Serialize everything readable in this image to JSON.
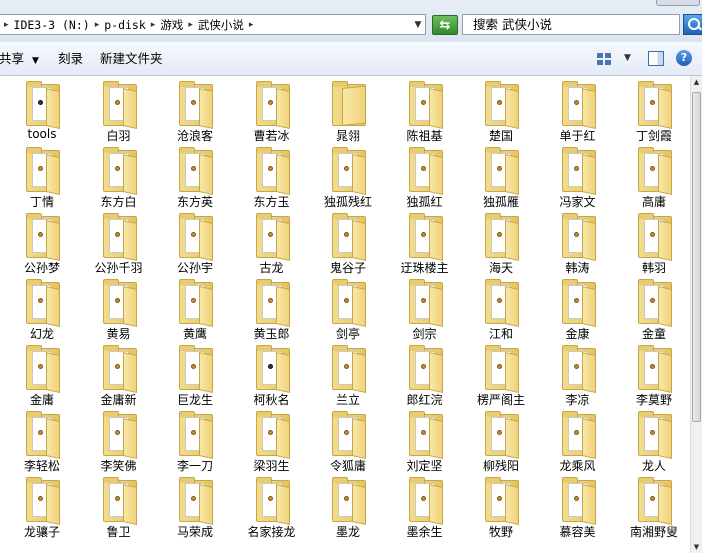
{
  "address": {
    "crumbs": [
      "IDE3-3 (N:)",
      "p-disk",
      "游戏",
      "武侠小说"
    ],
    "lead_arrow": "▸"
  },
  "search": {
    "value": "搜索 武侠小说"
  },
  "toolbar": {
    "share_label": "共享",
    "burn_label": "刻录",
    "new_folder_label": "新建文件夹",
    "help_glyph": "?"
  },
  "folders": [
    {
      "name": "tools",
      "icon": "paper-dark"
    },
    {
      "name": "白羽",
      "icon": "paper"
    },
    {
      "name": "沧浪客",
      "icon": "paper"
    },
    {
      "name": "曹若冰",
      "icon": "paper"
    },
    {
      "name": "晁翎",
      "icon": "open"
    },
    {
      "name": "陈祖基",
      "icon": "paper"
    },
    {
      "name": "楚国",
      "icon": "paper"
    },
    {
      "name": "单于红",
      "icon": "paper"
    },
    {
      "name": "丁剑霞",
      "icon": "paper"
    },
    {
      "name": "丁情",
      "icon": "paper"
    },
    {
      "name": "东方白",
      "icon": "paper"
    },
    {
      "name": "东方英",
      "icon": "paper"
    },
    {
      "name": "东方玉",
      "icon": "paper"
    },
    {
      "name": "独孤残红",
      "icon": "paper"
    },
    {
      "name": "独孤红",
      "icon": "paper"
    },
    {
      "name": "独孤雁",
      "icon": "paper"
    },
    {
      "name": "冯家文",
      "icon": "paper"
    },
    {
      "name": "高庸",
      "icon": "paper"
    },
    {
      "name": "公孙梦",
      "icon": "paper"
    },
    {
      "name": "公孙千羽",
      "icon": "paper"
    },
    {
      "name": "公孙宇",
      "icon": "paper"
    },
    {
      "name": "古龙",
      "icon": "paper"
    },
    {
      "name": "鬼谷子",
      "icon": "paper"
    },
    {
      "name": "迂珠楼主",
      "icon": "paper"
    },
    {
      "name": "海天",
      "icon": "paper"
    },
    {
      "name": "韩涛",
      "icon": "paper"
    },
    {
      "name": "韩羽",
      "icon": "paper"
    },
    {
      "name": "幻龙",
      "icon": "paper"
    },
    {
      "name": "黄易",
      "icon": "paper"
    },
    {
      "name": "黄鹰",
      "icon": "paper"
    },
    {
      "name": "黄玉郎",
      "icon": "paper"
    },
    {
      "name": "剑亭",
      "icon": "paper"
    },
    {
      "name": "剑宗",
      "icon": "paper"
    },
    {
      "name": "江和",
      "icon": "paper"
    },
    {
      "name": "金康",
      "icon": "paper"
    },
    {
      "name": "金童",
      "icon": "paper"
    },
    {
      "name": "金庸",
      "icon": "paper"
    },
    {
      "name": "金庸新",
      "icon": "paper"
    },
    {
      "name": "巨龙生",
      "icon": "paper"
    },
    {
      "name": "柯秋名",
      "icon": "paper-dark"
    },
    {
      "name": "兰立",
      "icon": "paper"
    },
    {
      "name": "郎红浣",
      "icon": "paper"
    },
    {
      "name": "楞严阁主",
      "icon": "paper"
    },
    {
      "name": "李凉",
      "icon": "paper"
    },
    {
      "name": "李莫野",
      "icon": "paper"
    },
    {
      "name": "李轻松",
      "icon": "paper"
    },
    {
      "name": "李笑佛",
      "icon": "paper"
    },
    {
      "name": "李一刀",
      "icon": "paper"
    },
    {
      "name": "梁羽生",
      "icon": "paper"
    },
    {
      "name": "令狐庸",
      "icon": "paper"
    },
    {
      "name": "刘定坚",
      "icon": "paper"
    },
    {
      "name": "柳残阳",
      "icon": "paper"
    },
    {
      "name": "龙乘风",
      "icon": "paper"
    },
    {
      "name": "龙人",
      "icon": "paper"
    },
    {
      "name": "龙骧子",
      "icon": "paper"
    },
    {
      "name": "鲁卫",
      "icon": "paper"
    },
    {
      "name": "马荣成",
      "icon": "paper"
    },
    {
      "name": "名家接龙",
      "icon": "paper"
    },
    {
      "name": "墨龙",
      "icon": "paper"
    },
    {
      "name": "墨余生",
      "icon": "paper"
    },
    {
      "name": "牧野",
      "icon": "paper"
    },
    {
      "name": "慕容美",
      "icon": "paper"
    },
    {
      "name": "南湘野叟",
      "icon": "paper"
    }
  ]
}
